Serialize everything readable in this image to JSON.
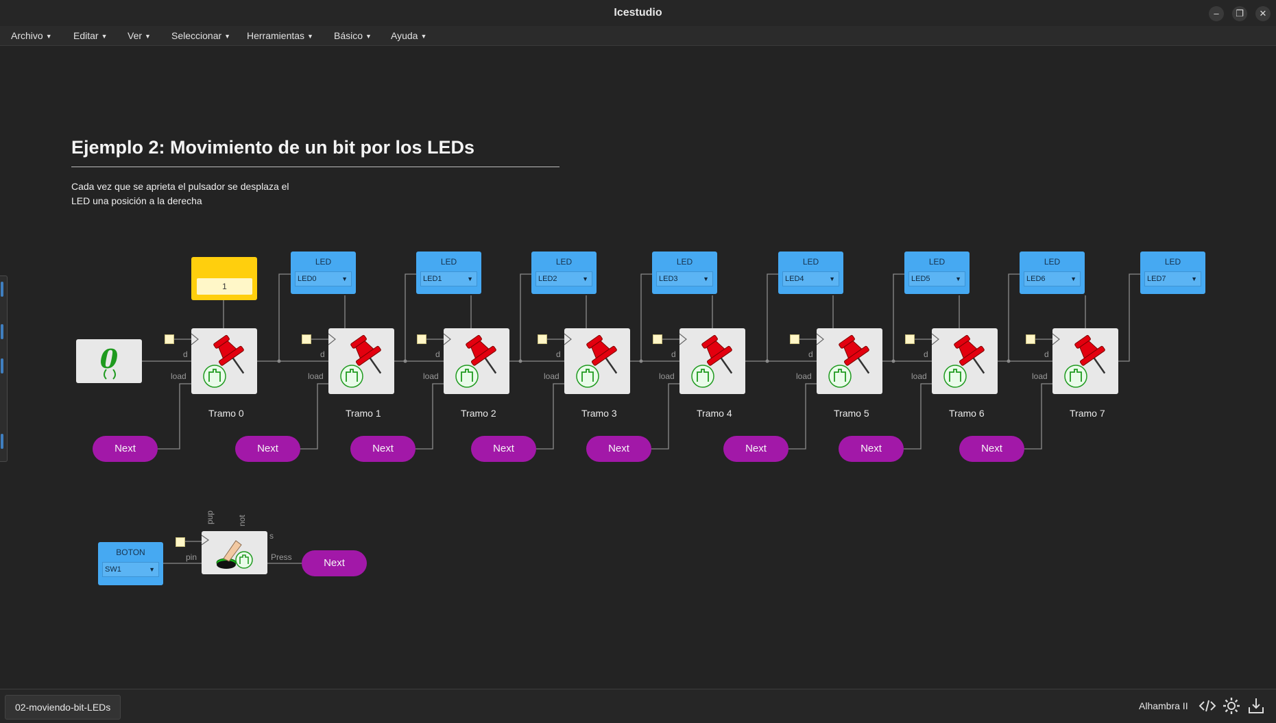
{
  "window": {
    "title": "Icestudio",
    "minimize_glyph": "–",
    "restore_glyph": "❐",
    "close_glyph": "✕"
  },
  "menu": [
    {
      "label": "Archivo"
    },
    {
      "label": "Editar"
    },
    {
      "label": "Ver"
    },
    {
      "label": "Seleccionar"
    },
    {
      "label": "Herramientas"
    },
    {
      "label": "Básico"
    },
    {
      "label": "Ayuda"
    }
  ],
  "doc": {
    "title": "Ejemplo 2: Movimiento de un bit por los LEDs",
    "desc_line1": "Cada vez que se aprieta el pulsador se desplaza el",
    "desc_line2": "LED una posición a la derecha"
  },
  "constant": {
    "value": "1"
  },
  "zero_block": {
    "glyph": "0"
  },
  "leds": [
    {
      "title": "LED",
      "pin": "LED0"
    },
    {
      "title": "LED",
      "pin": "LED1"
    },
    {
      "title": "LED",
      "pin": "LED2"
    },
    {
      "title": "LED",
      "pin": "LED3"
    },
    {
      "title": "LED",
      "pin": "LED4"
    },
    {
      "title": "LED",
      "pin": "LED5"
    },
    {
      "title": "LED",
      "pin": "LED6"
    },
    {
      "title": "LED",
      "pin": "LED7"
    }
  ],
  "registers": [
    {
      "label": "Tramo 0"
    },
    {
      "label": "Tramo 1"
    },
    {
      "label": "Tramo 2"
    },
    {
      "label": "Tramo 3"
    },
    {
      "label": "Tramo 4"
    },
    {
      "label": "Tramo 5"
    },
    {
      "label": "Tramo 6"
    },
    {
      "label": "Tramo 7"
    }
  ],
  "ports": {
    "d": "d",
    "load": "load",
    "pin": "pin",
    "pup": "pup",
    "not": "not",
    "s": "s",
    "press": "Press"
  },
  "next_label": "Next",
  "boton": {
    "title": "BOTON",
    "pin": "SW1"
  },
  "status": {
    "file": "02-moviendo-bit-LEDs",
    "board": "Alhambra II"
  },
  "colors": {
    "led_block": "#46a9f2",
    "next": "#a218a8",
    "constant": "#ffcf0d",
    "pin_red": "#e3000f",
    "green": "#1f9a1f"
  }
}
